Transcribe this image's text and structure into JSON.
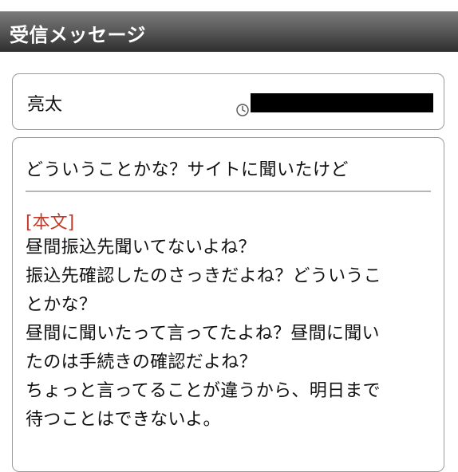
{
  "header": {
    "title": "受信メッセージ"
  },
  "sender": {
    "name": "亮太",
    "icon": "clock-icon"
  },
  "message": {
    "subject": "どういうことかな？サイトに聞いたけど",
    "body_label": "[本文]",
    "body_lines": [
      "昼間振込先聞いてないよね？",
      "振込先確認したのさっきだよね？どういうこ",
      "とかな？",
      "昼間に聞いたって言ってたよね？昼間に聞い",
      "たのは手続きの確認だよね？",
      "ちょっと言ってることが違うから、明日まで",
      "待つことはできないよ。"
    ]
  },
  "colors": {
    "header_dark": "#2f2f2f",
    "header_light": "#7a7a7a",
    "body_label": "#c0392b",
    "border": "#9a9a9a"
  }
}
